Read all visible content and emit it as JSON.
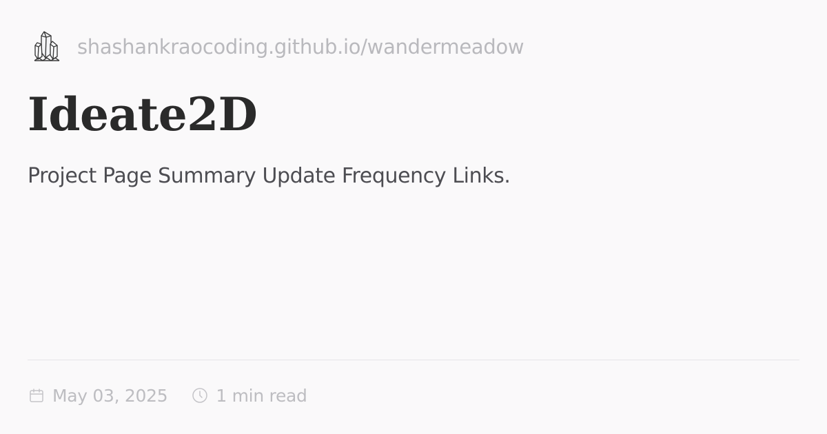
{
  "site": {
    "logo_icon": "crystal-cluster-icon",
    "url": "shashankraocoding.github.io/wandermeadow"
  },
  "post": {
    "title": "Ideate2D",
    "description": "Project Page Summary Update Frequency Links."
  },
  "meta": {
    "date_icon": "calendar-icon",
    "date": "May 03, 2025",
    "read_time_icon": "clock-icon",
    "read_time": "1 min read"
  },
  "colors": {
    "background": "#faf9fa",
    "title": "#2a2a2a",
    "muted": "#bdbdc1"
  }
}
